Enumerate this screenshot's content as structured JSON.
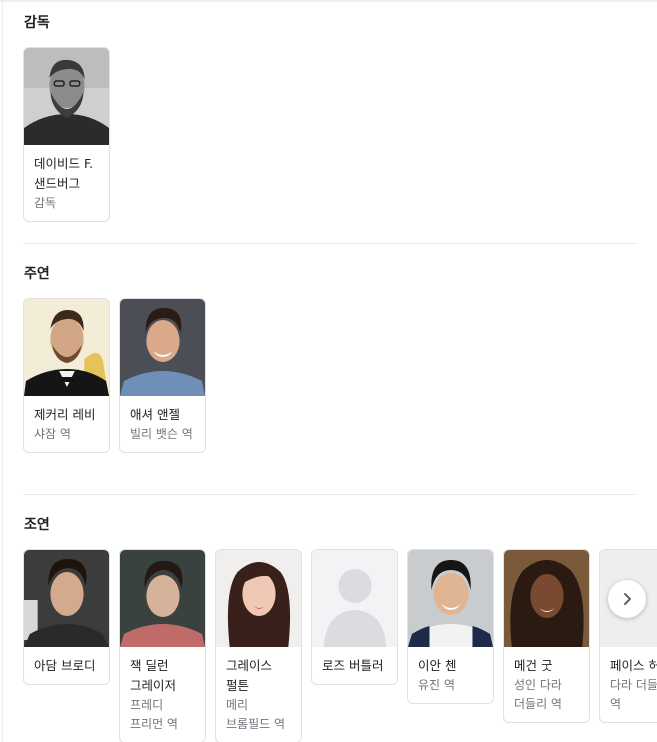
{
  "sections": {
    "director": {
      "title": "감독",
      "people": [
        {
          "name": "데이비드 F. 샌드버그",
          "role": "감독"
        }
      ]
    },
    "lead": {
      "title": "주연",
      "people": [
        {
          "name": "제커리 레비",
          "role": "샤잠 역"
        },
        {
          "name": "애셔 앤젤",
          "role": "빌리 뱃슨 역"
        }
      ]
    },
    "supporting": {
      "title": "조연",
      "people": [
        {
          "name": "아담 브로디",
          "role": ""
        },
        {
          "name": "잭 딜런 그레이저",
          "role": "프레디 프리먼 역"
        },
        {
          "name": "그레이스 펄튼",
          "role": "메리 브롬필드 역"
        },
        {
          "name": "로즈 버틀러",
          "role": ""
        },
        {
          "name": "이안 첸",
          "role": "유진 역"
        },
        {
          "name": "메건 굿",
          "role": "성인 다라 더들리 역"
        },
        {
          "name": "페이스 허만",
          "role": "다라 더들리 역"
        }
      ]
    }
  },
  "icons": {
    "next": "chevron-right-icon",
    "placeholder": "person-silhouette-icon"
  },
  "colors": {
    "card_border": "#dfe1e5",
    "role_text": "#70757a",
    "divider": "#ebebeb"
  }
}
